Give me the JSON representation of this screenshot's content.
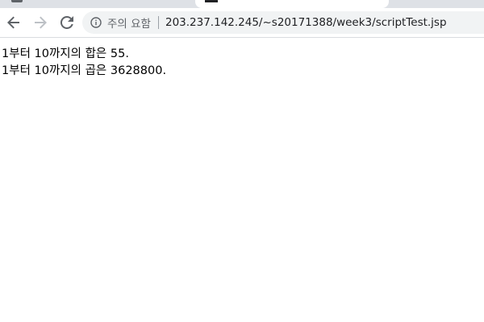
{
  "browser": {
    "security_label": "주의 요함",
    "url": "203.237.142.245/~s20171388/week3/scriptTest.jsp",
    "icons": {
      "back": "back-arrow-icon",
      "forward": "forward-arrow-icon",
      "reload": "reload-icon",
      "info": "info-icon"
    }
  },
  "page": {
    "lines": [
      "1부터 10까지의 합은 55.",
      "1부터 10까지의 곱은 3628800."
    ]
  }
}
